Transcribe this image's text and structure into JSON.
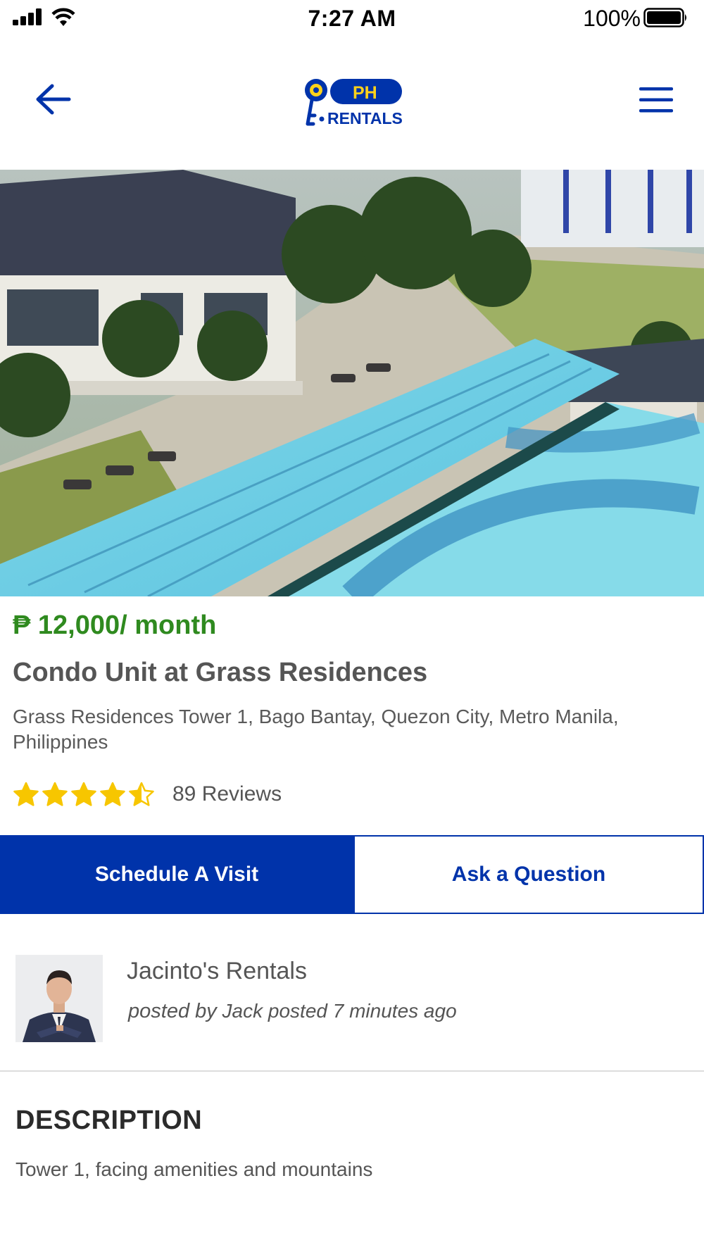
{
  "status_bar": {
    "time": "7:27 AM",
    "battery_percent": "100%",
    "icons": [
      "signal-icon",
      "wifi-icon",
      "battery-icon"
    ]
  },
  "nav": {
    "back_icon": "arrow-left-icon",
    "menu_icon": "hamburger-menu-icon",
    "logo": {
      "top_text": "PH",
      "bottom_text": "RENTALS"
    }
  },
  "listing": {
    "price": "₱ 12,000/ month",
    "title": "Condo Unit at Grass Residences",
    "address": "Grass Residences Tower 1, Bago Bantay, Quezon City, Metro Manila, Philippines",
    "rating_value": 4.5,
    "rating_max": 5,
    "reviews_label": "89 Reviews"
  },
  "actions": {
    "schedule_label": "Schedule A Visit",
    "ask_label": "Ask a Question"
  },
  "poster": {
    "name": "Jacinto's Rentals",
    "posted_by_prefix": "posted by",
    "posted_detail": "Jack posted 7 minutes ago"
  },
  "description": {
    "heading": "DESCRIPTION",
    "text": "Tower 1, facing amenities and mountains"
  },
  "colors": {
    "brand_blue": "#0033aa",
    "price_green": "#2f8a1f",
    "star_yellow": "#f7c600",
    "logo_yellow": "#ffd21a"
  }
}
